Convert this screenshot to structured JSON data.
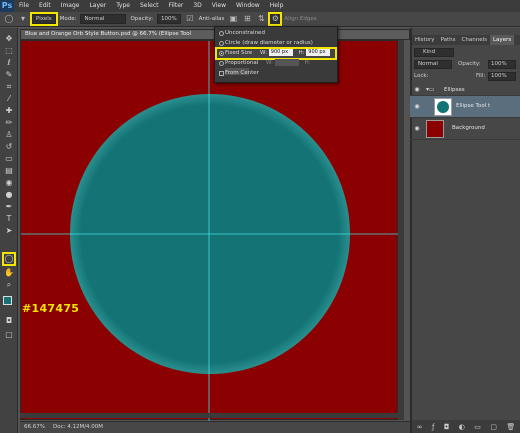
{
  "app": {
    "logo": "Ps"
  },
  "menu": [
    "File",
    "Edit",
    "Image",
    "Layer",
    "Type",
    "Select",
    "Filter",
    "3D",
    "View",
    "Window",
    "Help"
  ],
  "options_bar": {
    "units": "Pixels",
    "mode_label": "Mode:",
    "mode_value": "Normal",
    "opacity_label": "Opacity:",
    "opacity_value": "100%",
    "antialias_label": "Anti-alias",
    "align_edges_label": "Align Edges"
  },
  "geometry_menu": {
    "unconstrained": "Unconstrained",
    "circle": "Circle (draw diameter or radius)",
    "fixed_size": "Fixed Size",
    "w_label": "W:",
    "w_value": "900 px",
    "h_label": "H:",
    "h_value": "900 px",
    "proportional": "Proportional",
    "w2_label": "W:",
    "h2_label": "H:",
    "from_center": "From Center"
  },
  "document": {
    "title": "Blue and Orange Orb Style Button.psd @ 66.7% (Ellipse Tool",
    "zoom": "66.67%",
    "doc_info": "Doc: 4.12M/4.00M"
  },
  "callout": {
    "text": "#147475"
  },
  "colors": {
    "canvas": "#8b0000",
    "circle": "#147475",
    "guide": "#3fe0e0",
    "highlight": "#f2e600"
  },
  "panels": {
    "tabs": [
      "History",
      "Paths",
      "Channels",
      "Layers"
    ],
    "kind_label": "Kind",
    "blend_mode": "Normal",
    "opacity_label": "Opacity:",
    "opacity_value": "100%",
    "lock_label": "Lock:",
    "fill_label": "Fill:",
    "fill_value": "100%",
    "layers": [
      {
        "name": "Ellipses"
      },
      {
        "name": "Ellipse Tool t"
      },
      {
        "name": "Background"
      }
    ]
  }
}
